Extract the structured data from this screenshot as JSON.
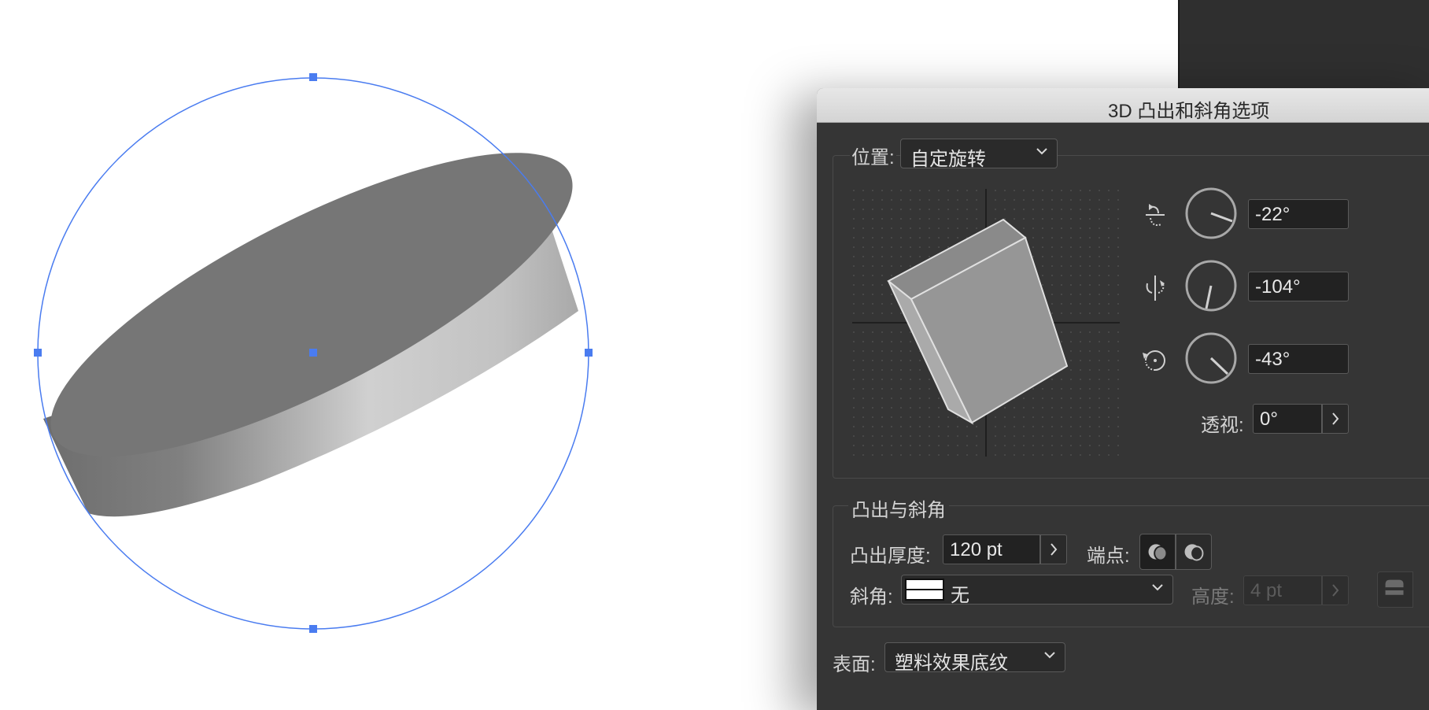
{
  "dialog": {
    "title": "3D 凸出和斜角选项"
  },
  "position": {
    "label": "位置:",
    "selected": "自定旋转"
  },
  "rotation": {
    "x_angle": "-22°",
    "y_angle": "-104°",
    "z_angle": "-43°",
    "perspective_label": "透视:",
    "perspective_value": "0°"
  },
  "extrude_bevel": {
    "section_label": "凸出与斜角",
    "depth_label": "凸出厚度:",
    "depth_value": "120 pt",
    "cap_label": "端点:",
    "bevel_label": "斜角:",
    "bevel_value": "无",
    "height_label": "高度:",
    "height_value": "4 pt"
  },
  "surface": {
    "label": "表面:",
    "selected": "塑料效果底纹"
  },
  "colors": {
    "selection_blue": "#4a7cf0",
    "dialog_bg": "#353535"
  },
  "icons": {
    "x_axis": "rotate-x-axis-icon",
    "y_axis": "rotate-y-axis-icon",
    "z_axis": "rotate-z-axis-icon",
    "dropdown": "chevron-down-icon",
    "stepper": "chevron-right-icon",
    "cap_on": "cap-on-icon",
    "cap_off": "cap-off-icon"
  }
}
